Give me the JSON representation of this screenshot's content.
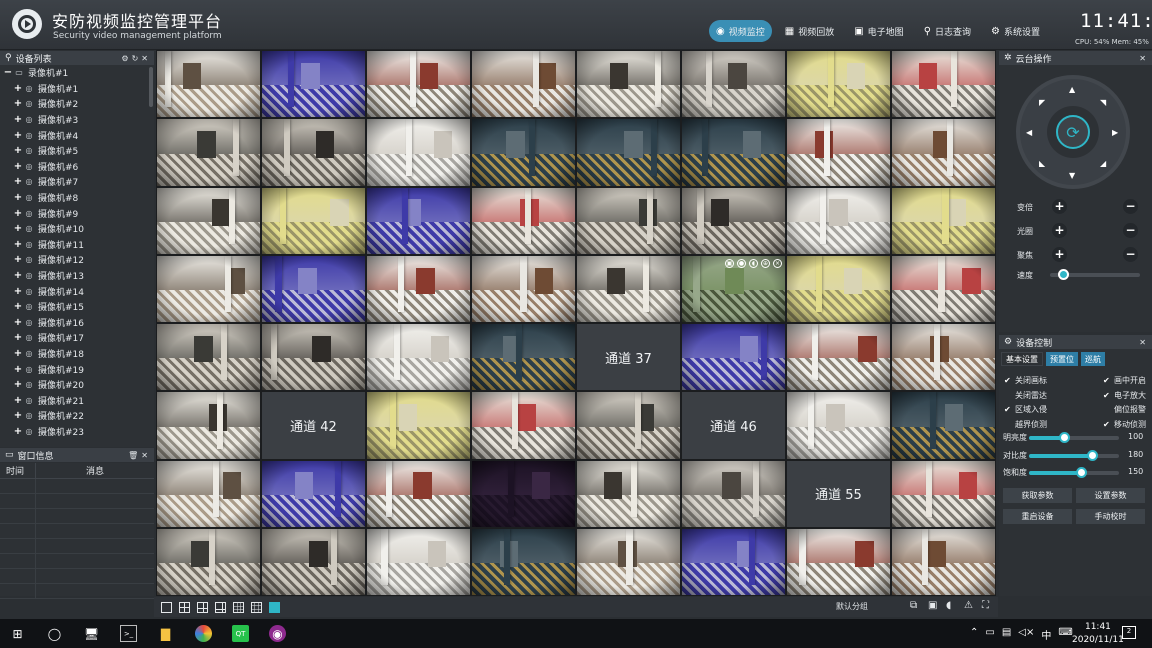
{
  "header": {
    "title": "安防视频监控管理平台",
    "subtitle": "Security video management platform",
    "nav": [
      {
        "label": "视频监控",
        "icon": "camera-icon",
        "active": true
      },
      {
        "label": "视频回放",
        "icon": "film-icon",
        "active": false
      },
      {
        "label": "电子地图",
        "icon": "map-icon",
        "active": false
      },
      {
        "label": "日志查询",
        "icon": "search-icon",
        "active": false
      },
      {
        "label": "系统设置",
        "icon": "gear-icon",
        "active": false
      }
    ],
    "clock": "11:41:05",
    "stats": "CPU: 54% Mem: 45%"
  },
  "device_list": {
    "title": "设备列表",
    "root": "录像机#1",
    "cameras": [
      "摄像机#1",
      "摄像机#2",
      "摄像机#3",
      "摄像机#4",
      "摄像机#5",
      "摄像机#6",
      "摄像机#7",
      "摄像机#8",
      "摄像机#9",
      "摄像机#10",
      "摄像机#11",
      "摄像机#12",
      "摄像机#13",
      "摄像机#14",
      "摄像机#15",
      "摄像机#16",
      "摄像机#17",
      "摄像机#18",
      "摄像机#19",
      "摄像机#20",
      "摄像机#21",
      "摄像机#22",
      "摄像机#23"
    ]
  },
  "window_info": {
    "title": "窗口信息",
    "col_time": "时间",
    "col_msg": "消息"
  },
  "grid": {
    "channels": [
      {
        "n": 1,
        "empty": false
      },
      {
        "n": 2,
        "empty": false
      },
      {
        "n": 3,
        "empty": false
      },
      {
        "n": 4,
        "empty": false
      },
      {
        "n": 5,
        "empty": false
      },
      {
        "n": 6,
        "empty": false
      },
      {
        "n": 7,
        "empty": false
      },
      {
        "n": 8,
        "empty": false
      },
      {
        "n": 9,
        "empty": false
      },
      {
        "n": 10,
        "empty": false
      },
      {
        "n": 11,
        "empty": false
      },
      {
        "n": 12,
        "empty": false
      },
      {
        "n": 13,
        "empty": false
      },
      {
        "n": 14,
        "empty": false
      },
      {
        "n": 15,
        "empty": false
      },
      {
        "n": 16,
        "empty": false
      },
      {
        "n": 17,
        "empty": false
      },
      {
        "n": 18,
        "empty": false
      },
      {
        "n": 19,
        "empty": false
      },
      {
        "n": 20,
        "empty": false
      },
      {
        "n": 21,
        "empty": false
      },
      {
        "n": 22,
        "empty": false
      },
      {
        "n": 23,
        "empty": false
      },
      {
        "n": 24,
        "empty": false
      },
      {
        "n": 25,
        "empty": false
      },
      {
        "n": 26,
        "empty": false
      },
      {
        "n": 27,
        "empty": false
      },
      {
        "n": 28,
        "empty": false
      },
      {
        "n": 29,
        "empty": false
      },
      {
        "n": 30,
        "empty": false
      },
      {
        "n": 31,
        "empty": false
      },
      {
        "n": 32,
        "empty": false
      },
      {
        "n": 33,
        "empty": false
      },
      {
        "n": 34,
        "empty": false
      },
      {
        "n": 35,
        "empty": false
      },
      {
        "n": 36,
        "empty": false
      },
      {
        "n": 37,
        "empty": true,
        "label": "通道 37"
      },
      {
        "n": 38,
        "empty": false
      },
      {
        "n": 39,
        "empty": false
      },
      {
        "n": 40,
        "empty": false
      },
      {
        "n": 41,
        "empty": false
      },
      {
        "n": 42,
        "empty": true,
        "label": "通道 42"
      },
      {
        "n": 43,
        "empty": false
      },
      {
        "n": 44,
        "empty": false
      },
      {
        "n": 45,
        "empty": false
      },
      {
        "n": 46,
        "empty": true,
        "label": "通道 46"
      },
      {
        "n": 47,
        "empty": false
      },
      {
        "n": 48,
        "empty": false
      },
      {
        "n": 49,
        "empty": false
      },
      {
        "n": 50,
        "empty": false
      },
      {
        "n": 51,
        "empty": false
      },
      {
        "n": 52,
        "empty": false
      },
      {
        "n": 53,
        "empty": false
      },
      {
        "n": 54,
        "empty": false
      },
      {
        "n": 55,
        "empty": true,
        "label": "通道 55"
      },
      {
        "n": 56,
        "empty": false
      },
      {
        "n": 57,
        "empty": false
      },
      {
        "n": 58,
        "empty": false
      },
      {
        "n": 59,
        "empty": false
      },
      {
        "n": 60,
        "empty": false
      },
      {
        "n": 61,
        "empty": false
      },
      {
        "n": 62,
        "empty": false
      },
      {
        "n": 63,
        "empty": false
      },
      {
        "n": 64,
        "empty": false
      }
    ]
  },
  "toolbar": {
    "group": "默认分组"
  },
  "ptz": {
    "title": "云台操作",
    "zoom_label": "变倍",
    "iris_label": "光圈",
    "focus_label": "聚焦",
    "speed_label": "速度",
    "speed_value": 0.12
  },
  "device_control": {
    "title": "设备控制",
    "tabs": [
      "基本设置",
      "预置位",
      "巡航"
    ],
    "options": [
      {
        "label": "关闭画标",
        "checked": true
      },
      {
        "label": "画中开启",
        "checked": true
      },
      {
        "label": "关闭雷达",
        "checked": false
      },
      {
        "label": "电子放大",
        "checked": true
      },
      {
        "label": "区域入侵",
        "checked": true
      },
      {
        "label": "偏位报警",
        "checked": false
      },
      {
        "label": "越界侦测",
        "checked": false
      },
      {
        "label": "移动侦测",
        "checked": true
      }
    ],
    "sliders": [
      {
        "label": "明亮度",
        "value": "100",
        "fraction": 0.39
      },
      {
        "label": "对比度",
        "value": "180",
        "fraction": 0.7
      },
      {
        "label": "饱和度",
        "value": "150",
        "fraction": 0.58
      }
    ],
    "buttons": [
      "获取参数",
      "设置参数",
      "重启设备",
      "手动校时"
    ]
  },
  "taskbar": {
    "time": "11:41",
    "date": "2020/11/11",
    "ime": "中",
    "notifications": "2"
  }
}
